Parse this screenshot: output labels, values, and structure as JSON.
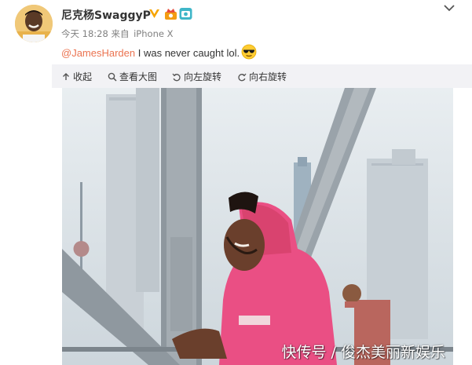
{
  "post": {
    "username": "尼克杨SwaggyP",
    "time": "今天 18:28",
    "source_prefix": "来自",
    "device": "iPhone X",
    "mention": "@JamesHarden",
    "text": " I was never caught lol.",
    "emoji": "sunglasses-emoji"
  },
  "toolbar": {
    "collapse": "收起",
    "view_large": "查看大图",
    "rotate_left": "向左旋转",
    "rotate_right": "向右旋转"
  },
  "watermark": "快传号 / 俊杰美丽新娱乐",
  "colors": {
    "mention": "#eb7350",
    "toolbar_bg": "#f2f2f5",
    "verified": "#f6a400",
    "hoodie": "#ea4f84"
  }
}
